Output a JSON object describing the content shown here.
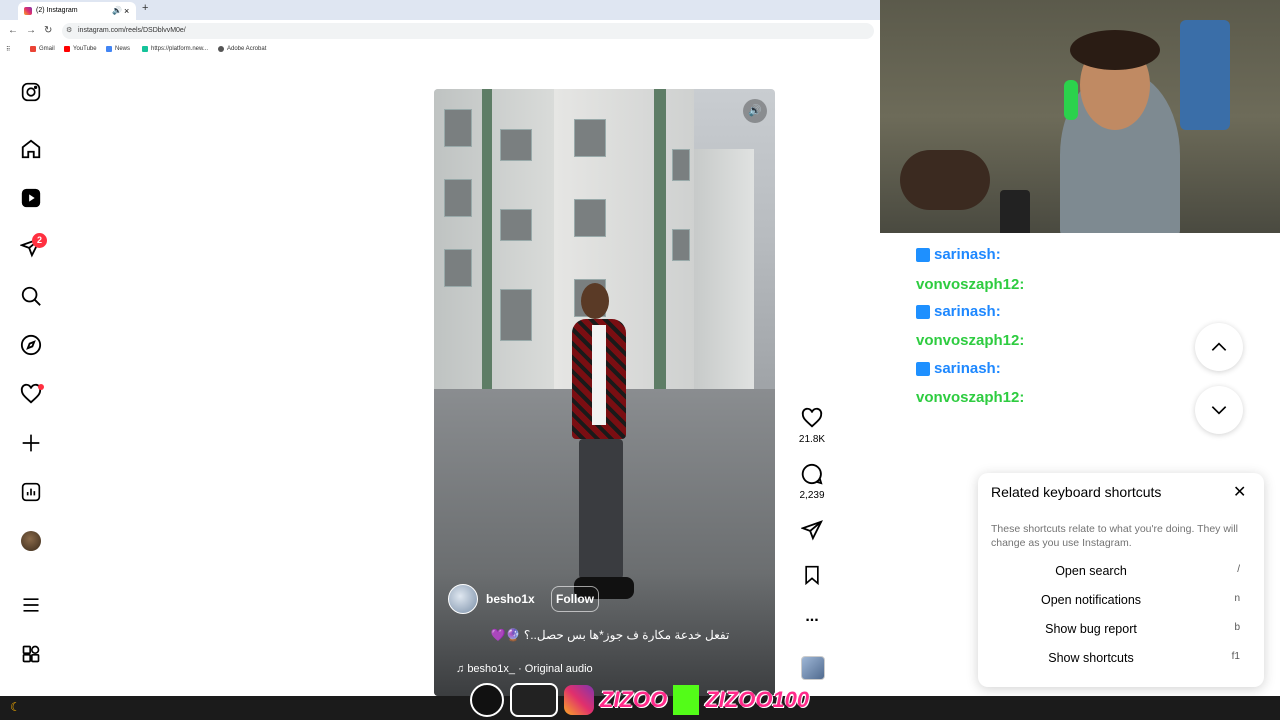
{
  "browser": {
    "tab_title": "(2) Instagram",
    "new_tab": "+",
    "url": "instagram.com/reels/DSDblvvM0e/",
    "bookmarks": [
      "Gmail",
      "YouTube",
      "News",
      "https://platform.new...",
      "Adobe Acrobat"
    ]
  },
  "sidebar": {
    "messages_badge": "2",
    "items": [
      "instagram-logo",
      "home",
      "reels",
      "messages",
      "search",
      "explore",
      "notifications",
      "create",
      "dashboard",
      "profile",
      "more",
      "also-from-meta"
    ]
  },
  "reel": {
    "author": "besho1x",
    "follow_label": "Follow",
    "caption": "تفعل خدعة مكارة ف جوز*ها بس حصل..؟ 🔮💜",
    "audio": "besho1x_ · Original audio",
    "likes": "21.8K",
    "comments": "2,239",
    "more": "..."
  },
  "chat": {
    "lines": [
      {
        "user": "sarinash:",
        "color": "#1e88ff",
        "badge": true
      },
      {
        "user": "vonvoszaph12:",
        "color": "#2ecc40",
        "badge": false
      },
      {
        "user": "sarinash:",
        "color": "#1e88ff",
        "badge": true
      },
      {
        "user": "vonvoszaph12:",
        "color": "#2ecc40",
        "badge": false
      },
      {
        "user": "sarinash:",
        "color": "#1e88ff",
        "badge": true
      },
      {
        "user": "vonvoszaph12:",
        "color": "#2ecc40",
        "badge": false
      }
    ]
  },
  "shortcuts": {
    "title": "Related keyboard shortcuts",
    "description": "These shortcuts relate to what you're doing. They will change as you use Instagram.",
    "rows": [
      {
        "label": "Open search",
        "key": "/"
      },
      {
        "label": "Open notifications",
        "key": "n"
      },
      {
        "label": "Show bug report",
        "key": "b"
      },
      {
        "label": "Show shortcuts",
        "key": "f1"
      }
    ]
  },
  "overlay": {
    "brand_1": "ZIZOO",
    "brand_2": "ZIZOO100"
  },
  "colors": {
    "accent_red": "#ff3040",
    "chat_blue": "#1e88ff",
    "chat_green": "#2ecc40"
  }
}
